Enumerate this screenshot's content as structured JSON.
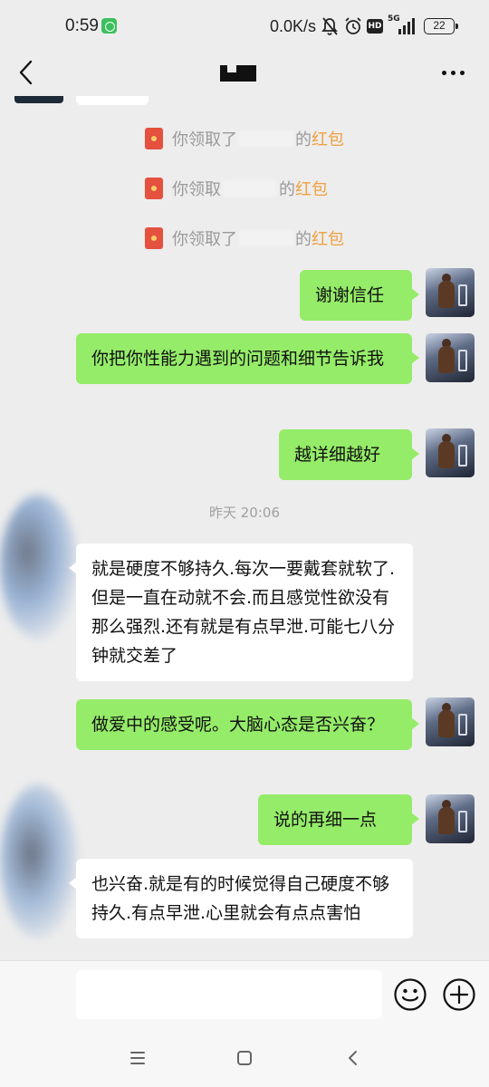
{
  "status_bar": {
    "time": "0:59",
    "net_speed": "0.0K/s",
    "hd_label": "HD",
    "network_label": "5G",
    "battery": "22"
  },
  "colors": {
    "background": "#ededed",
    "sent_bubble": "#95ec69",
    "received_bubble": "#ffffff",
    "red_packet_text": "#f0a040"
  },
  "system_messages": [
    {
      "prefix": "你领取了",
      "suffix": "的",
      "red_packet": "红包"
    },
    {
      "prefix": "你领取",
      "suffix": "的",
      "red_packet": "红包"
    },
    {
      "prefix": "你领取了",
      "suffix": "的",
      "red_packet": "红包"
    }
  ],
  "timestamp": "昨天 20:06",
  "messages": [
    {
      "side": "right",
      "text": "谢谢信任"
    },
    {
      "side": "right",
      "text": "你把你性能力遇到的问题和细节告诉我"
    },
    {
      "side": "right",
      "text": "越详细越好"
    },
    {
      "side": "left",
      "text": "就是硬度不够持久.每次一要戴套就软了.但是一直在动就不会.而且感觉性欲没有那么强烈.还有就是有点早泄.可能七八分钟就交差了"
    },
    {
      "side": "right",
      "text": "做爱中的感受呢。大脑心态是否兴奋？"
    },
    {
      "side": "right",
      "text": "说的再细一点"
    },
    {
      "side": "left",
      "text": "也兴奋.就是有的时候觉得自己硬度不够持久.有点早泄.心里就会有点点害怕"
    }
  ],
  "icons": {
    "back": "chevron-left-icon",
    "more": "more-dots-icon",
    "emoji": "emoji-icon",
    "plus": "plus-icon",
    "red_packet": "red-packet-icon"
  }
}
